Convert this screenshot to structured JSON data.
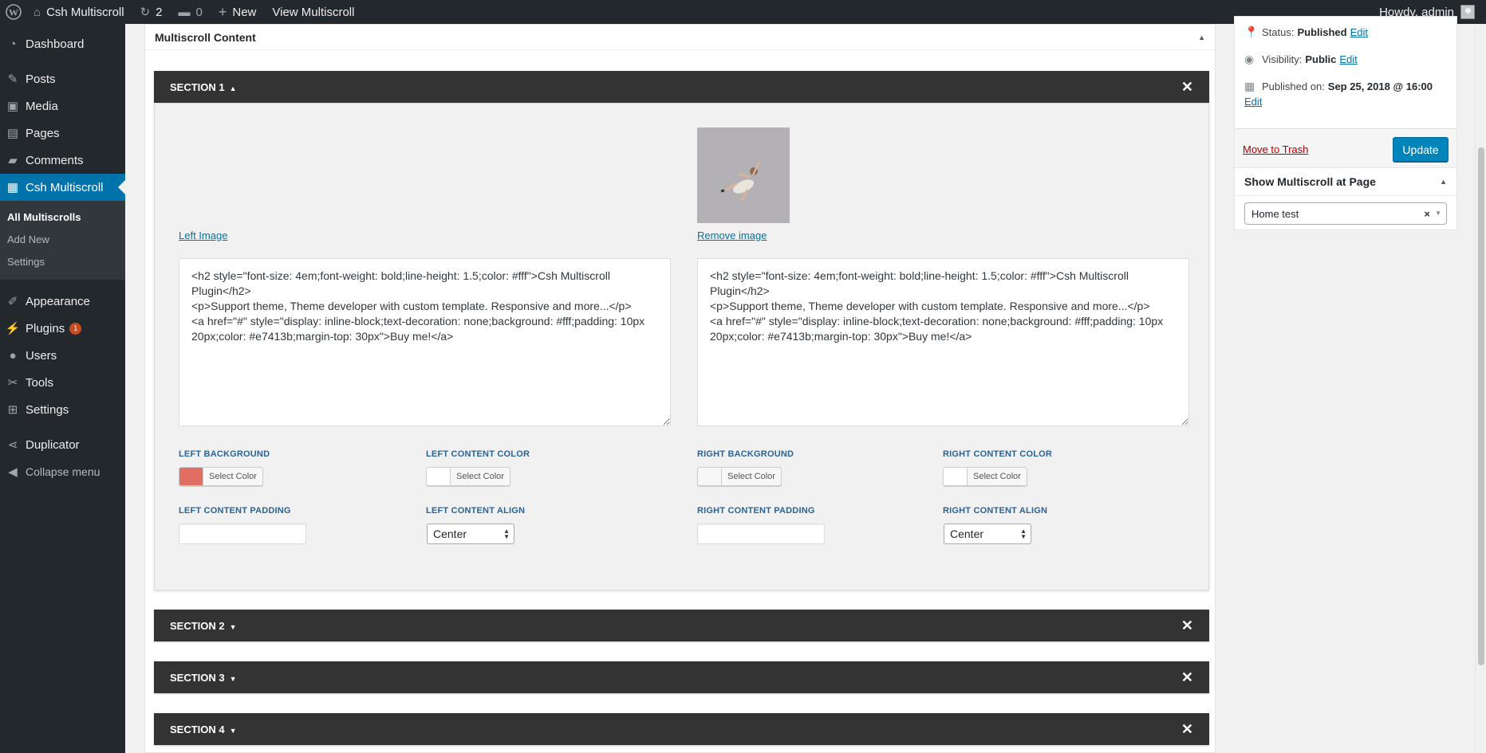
{
  "adminbar": {
    "site_name": "Csh Multiscroll",
    "updates_count": "2",
    "comments_count": "0",
    "new_label": "New",
    "view_label": "View Multiscroll",
    "howdy": "Howdy, admin"
  },
  "sidebar": {
    "items": [
      {
        "label": "Dashboard",
        "icon": "dashboard-icon",
        "glyph": "◔"
      },
      {
        "label": "Posts",
        "icon": "pin-icon",
        "glyph": "✎"
      },
      {
        "label": "Media",
        "icon": "media-icon",
        "glyph": "▣"
      },
      {
        "label": "Pages",
        "icon": "page-icon",
        "glyph": "▤"
      },
      {
        "label": "Comments",
        "icon": "comment-icon",
        "glyph": "▰"
      },
      {
        "label": "Csh Multiscroll",
        "icon": "multiscroll-icon",
        "glyph": "▦"
      }
    ],
    "submenu": [
      "All Multiscrolls",
      "Add New",
      "Settings"
    ],
    "items2": [
      {
        "label": "Appearance",
        "icon": "brush-icon",
        "glyph": "✐"
      },
      {
        "label": "Plugins",
        "icon": "plugin-icon",
        "glyph": "⚡",
        "badge": "1"
      },
      {
        "label": "Users",
        "icon": "users-icon",
        "glyph": "●"
      },
      {
        "label": "Tools",
        "icon": "wrench-icon",
        "glyph": "✂"
      },
      {
        "label": "Settings",
        "icon": "settings-icon",
        "glyph": "⊞"
      }
    ],
    "items3": [
      {
        "label": "Duplicator",
        "icon": "share-icon",
        "glyph": "⋖"
      },
      {
        "label": "Collapse menu",
        "icon": "collapse-icon",
        "glyph": "◀"
      }
    ]
  },
  "content_box": {
    "title": "Multiscroll Content",
    "sections": [
      "SECTION 1",
      "SECTION 2",
      "SECTION 3",
      "SECTION 4"
    ],
    "left_image_link": "Left Image",
    "remove_image_link": "Remove image",
    "left_content": "<h2 style=\"font-size: 4em;font-weight: bold;line-height: 1.5;color: #fff\">Csh Multiscroll Plugin</h2>\n<p>Support theme, Theme developer with custom template. Responsive and more...</p>\n<a href=\"#\" style=\"display: inline-block;text-decoration: none;background: #fff;padding: 10px 20px;color: #e7413b;margin-top: 30px\">Buy me!</a>",
    "right_content": "<h2 style=\"font-size: 4em;font-weight: bold;line-height: 1.5;color: #fff\">Csh Multiscroll Plugin</h2>\n<p>Support theme, Theme developer with custom template. Responsive and more...</p>\n<a href=\"#\" style=\"display: inline-block;text-decoration: none;background: #fff;padding: 10px 20px;color: #e7413b;margin-top: 30px\">Buy me!</a>",
    "labels": {
      "left_background": "LEFT BACKGROUND",
      "left_content_color": "LEFT CONTENT COLOR",
      "right_background": "RIGHT BACKGROUND",
      "right_content_color": "RIGHT CONTENT COLOR",
      "left_content_padding": "LEFT CONTENT PADDING",
      "left_content_align": "LEFT CONTENT ALIGN",
      "right_content_padding": "RIGHT CONTENT PADDING",
      "right_content_align": "RIGHT CONTENT ALIGN"
    },
    "select_color_label": "Select Color",
    "left_background_color": "#e06e62",
    "left_content_color_value": "#ffffff",
    "right_background_color": "#f7f7f7",
    "right_content_color_value": "#ffffff",
    "left_align_value": "Center",
    "right_align_value": "Center"
  },
  "publish": {
    "status_label": "Status:",
    "status_value": "Published",
    "visibility_label": "Visibility:",
    "visibility_value": "Public",
    "published_label": "Published on:",
    "published_value": "Sep 25, 2018 @ 16:00",
    "edit_label": "Edit",
    "trash_label": "Move to Trash",
    "update_label": "Update"
  },
  "page_box": {
    "title": "Show Multiscroll at Page",
    "selected_page": "Home test"
  },
  "colors": {
    "accent": "#0073aa",
    "adminbar_bg": "#23282d",
    "section_bar_bg": "#333333"
  }
}
